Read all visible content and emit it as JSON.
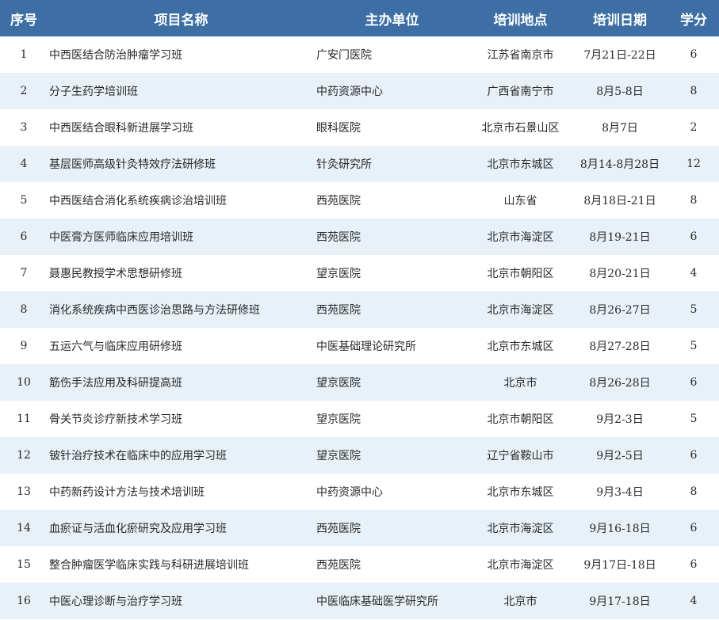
{
  "header": {
    "seq": "序号",
    "name": "项目名称",
    "org": "主办单位",
    "location": "培训地点",
    "date": "培训日期",
    "credit": "学分"
  },
  "rows": [
    {
      "seq": "1",
      "name": "中西医结合防治肿瘤学习班",
      "org": "广安门医院",
      "location": "江苏省南京市",
      "date": "7月21日-22日",
      "credit": "6"
    },
    {
      "seq": "2",
      "name": "分子生药学培训班",
      "org": "中药资源中心",
      "location": "广西省南宁市",
      "date": "8月5-8日",
      "credit": "8"
    },
    {
      "seq": "3",
      "name": "中西医结合眼科新进展学习班",
      "org": "眼科医院",
      "location": "北京市石景山区",
      "date": "8月7日",
      "credit": "2"
    },
    {
      "seq": "4",
      "name": "基层医师高级针灸特效疗法研修班",
      "org": "针灸研究所",
      "location": "北京市东城区",
      "date": "8月14-8月28日",
      "credit": "12"
    },
    {
      "seq": "5",
      "name": "中西医结合消化系统疾病诊治培训班",
      "org": "西苑医院",
      "location": "山东省",
      "date": "8月18日-21日",
      "credit": "8"
    },
    {
      "seq": "6",
      "name": "中医膏方医师临床应用培训班",
      "org": "西苑医院",
      "location": "北京市海淀区",
      "date": "8月19-21日",
      "credit": "6"
    },
    {
      "seq": "7",
      "name": "聂惠民教授学术思想研修班",
      "org": "望京医院",
      "location": "北京市朝阳区",
      "date": "8月20-21日",
      "credit": "4"
    },
    {
      "seq": "8",
      "name": "消化系统疾病中西医诊治思路与方法研修班",
      "org": "西苑医院",
      "location": "北京市海淀区",
      "date": "8月26-27日",
      "credit": "5"
    },
    {
      "seq": "9",
      "name": "五运六气与临床应用研修班",
      "org": "中医基础理论研究所",
      "location": "北京市东城区",
      "date": "8月27-28日",
      "credit": "5"
    },
    {
      "seq": "10",
      "name": "筋伤手法应用及科研提高班",
      "org": "望京医院",
      "location": "北京市",
      "date": "8月26-28日",
      "credit": "6"
    },
    {
      "seq": "11",
      "name": "骨关节炎诊疗新技术学习班",
      "org": "望京医院",
      "location": "北京市朝阳区",
      "date": "9月2-3日",
      "credit": "5"
    },
    {
      "seq": "12",
      "name": "铍针治疗技术在临床中的应用学习班",
      "org": "望京医院",
      "location": "辽宁省鞍山市",
      "date": "9月2-5日",
      "credit": "6"
    },
    {
      "seq": "13",
      "name": "中药新药设计方法与技术培训班",
      "org": "中药资源中心",
      "location": "北京市东城区",
      "date": "9月3-4日",
      "credit": "8"
    },
    {
      "seq": "14",
      "name": "血瘀证与活血化瘀研究及应用学习班",
      "org": "西苑医院",
      "location": "北京市海淀区",
      "date": "9月16-18日",
      "credit": "6"
    },
    {
      "seq": "15",
      "name": "整合肿瘤医学临床实践与科研进展培训班",
      "org": "西苑医院",
      "location": "北京市海淀区",
      "date": "9月17日-18日",
      "credit": "6"
    },
    {
      "seq": "16",
      "name": "中医心理诊断与治疗学习班",
      "org": "中医临床基础医学研究所",
      "location": "北京市",
      "date": "9月17-18日",
      "credit": "4"
    }
  ],
  "colors": {
    "header_bg": "#3d6fa5",
    "header_text": "#ffffff",
    "stripe": "#e8f0f8",
    "text": "#2a2a2a"
  }
}
